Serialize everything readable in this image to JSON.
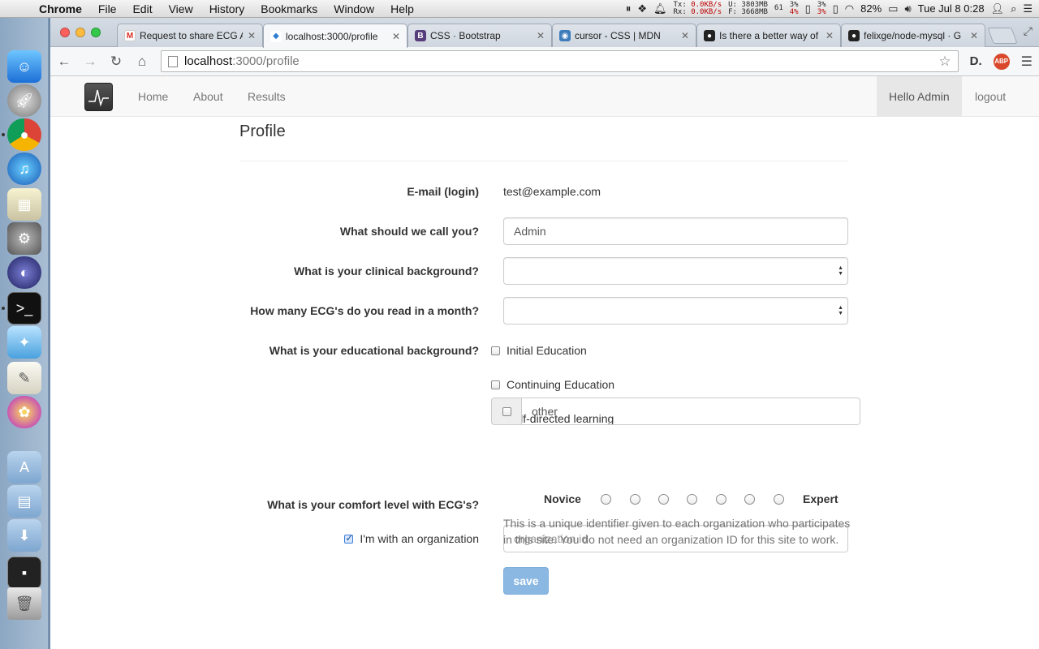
{
  "menubar": {
    "app": "Chrome",
    "items": [
      "File",
      "Edit",
      "View",
      "History",
      "Bookmarks",
      "Window",
      "Help"
    ],
    "net_tx": "0.0KB/s",
    "net_rx": "0.0KB/s",
    "tx_label": "Tx:",
    "rx_label": "Rx:",
    "mem_used": "U: 3803MB",
    "mem_free": "F: 3668MB",
    "temp": "61",
    "cpu_a": "3%",
    "cpu_b": "4%",
    "cpu_c": "3%",
    "cpu_d": "3%",
    "battery": "82%",
    "clock": "Tue Jul 8  0:28"
  },
  "tabs": [
    {
      "label": "Request to share ECG A",
      "favicon": "gmail-icon",
      "color": "#d93025",
      "glyph": "M"
    },
    {
      "label": "localhost:3000/profile",
      "favicon": "localhost-icon",
      "color": "#2d7dd2",
      "glyph": "◆",
      "active": true
    },
    {
      "label": "CSS · Bootstrap",
      "favicon": "bootstrap-icon",
      "color": "#563d7c",
      "glyph": "B"
    },
    {
      "label": "cursor - CSS | MDN",
      "favicon": "mdn-icon",
      "color": "#3e7cba",
      "glyph": "◉"
    },
    {
      "label": "Is there a better way of",
      "favicon": "github-icon",
      "color": "#222222",
      "glyph": "●"
    },
    {
      "label": "felixge/node-mysql · G",
      "favicon": "github-icon",
      "color": "#222222",
      "glyph": "●"
    }
  ],
  "address_bar": {
    "host": "localhost",
    "path": ":3000/profile"
  },
  "navbar": {
    "links": [
      "Home",
      "About",
      "Results"
    ],
    "greeting": "Hello Admin",
    "logout": "logout"
  },
  "profile": {
    "title": "Profile",
    "email_label": "E-mail (login)",
    "email_value": "test@example.com",
    "name_label": "What should we call you?",
    "name_value": "Admin",
    "clinical_label": "What is your clinical background?",
    "clinical_value": "",
    "ecg_count_label": "How many ECG's do you read in a month?",
    "ecg_count_value": "",
    "education_label": "What is your educational background?",
    "education_options": [
      {
        "label": "Initial Education",
        "checked": false
      },
      {
        "label": "Continuing Education",
        "checked": false
      },
      {
        "label": "Self-directed learning",
        "checked": false
      }
    ],
    "other_placeholder": "other",
    "comfort_label": "What is your comfort level with ECG's?",
    "comfort_min": "Novice",
    "comfort_max": "Expert",
    "comfort_levels": 7,
    "org_label": "I'm with an organization",
    "org_checked": true,
    "org_placeholder": "organization id",
    "org_help": "This is a unique identifier given to each organization who participates in this site. You do not need an organization ID for this site to work.",
    "save_label": "save"
  }
}
